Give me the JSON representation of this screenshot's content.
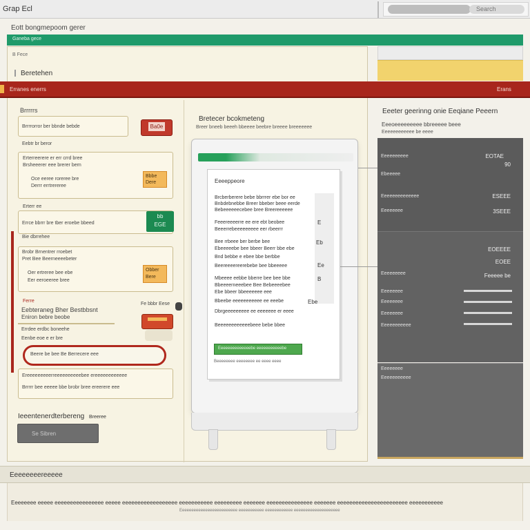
{
  "window": {
    "title": "Grap Ecl",
    "search_placeholder": "Search"
  },
  "breadcrumb": "Eott bongmepoom gerer",
  "green_band": "Ganeba gece",
  "left_panel": {
    "tag": "B Fece",
    "section_title": "Beretehen"
  },
  "red_band": {
    "title": "Erranes enerrs",
    "right_label": "Erans"
  },
  "forms": {
    "group1": {
      "heading": "Brrrrrs",
      "line1": "Brrrrorror ber bbnde bebde",
      "line2": "Eebtr br beror",
      "badge": "Ba0e"
    },
    "group2": {
      "line1": "Erterreerere er err crrd bree",
      "line2": "Brsheeerer eee brerer bern",
      "line3": "Oce eeree roreree bre",
      "line4": "Derrr errtrereree",
      "badge": "Bbbe Dere"
    },
    "group3": {
      "heading": "Erterr ee",
      "line1": "Errce bbrrr bre tber eroebe bbeed",
      "line2": "Bie dbrrehee",
      "badge_line1": "bb",
      "badge_line2": "EGE"
    },
    "group4": {
      "line1": "Brobr Brnentrer rroebet",
      "line2": "Pret Bee Beerneeeebeter",
      "line3": "Oer ertreree bee ebe",
      "line4": "Eer eeroeeree bree",
      "badge": "Obber Bere"
    },
    "group5": {
      "tag": "Ferre",
      "title": "Eebteraneg Bher Bestbbsnt",
      "subtitle": "Eniron bebre beobe",
      "side_label": "Fe bbbr Eese",
      "line1": "Errdee erdbc boneehe",
      "line2": "Eenbe eoe e er bre"
    },
    "oval_text": "Beere be bee Be Berrecere eee",
    "paragraph1": "Ereeeeeeeeerreeeeeeeeeebee ereeeeeeeeeeee",
    "paragraph2": "Brrrrr bee eeeee bbe brobr bree ereerere eee",
    "bottom_label": "Ieeentenerdterbereng",
    "bottom_label_suffix": "Breeree",
    "button_label": "Se Sibren"
  },
  "preview": {
    "title": "Bretecer bcokmeteng",
    "subtitle": "Breer bneeb beeeh bbeeee beebre breeee breeeeeee",
    "document": {
      "title": "Eeeeppeore",
      "lines": [
        "Brcberberere bebe bbrrrer ebe bor ee",
        "Bnbdebnebbe Breer bbeber beee eerde",
        "Bebeeeeeecebee bree Breereeeeee",
        "Feeereeeerre ee ere ebt beobee",
        "Beeerrebeeeeeeeee eer rbeerrr",
        "Bee rrbeee ber berbe bee",
        "Ebeeeeebe bee bbeer Beerr bbe ebe",
        "Bnd bebbe e ebee bbe berbbe",
        "Beereeeereerebebe bee bbeeeee",
        "Mbeeee eebbe bberre bee bee bbe",
        "Bbeeeerneeebee Bee Bebeeeebee",
        "Ebe bbeer bbeeeeeee eee",
        "Bbeebe eeeeeeeeeee ee eeebe",
        "Dbrgeeeeeeeee ee eeeeeee er eeee",
        "Beeeeeeeeeeeebeee bebe bbee"
      ],
      "side_marks": [
        "E",
        "Eb",
        "Ee",
        "Ebe",
        "B"
      ],
      "green_bar": "Eeeeeeeeeeeeeebe eeeeeeeeeeebe",
      "caption": "Beeeeeeee eeeeeeee ee eeee eeee"
    }
  },
  "right_panel": {
    "title": "Eeeter geerinng onie Eeqiane Peeern",
    "subtitle": "Eeeoeeeeeeeee bbreeeee beee",
    "subtitle2": "Eeeeeeeeeeee be eeee",
    "rows": [
      {
        "label": "Eeeeeeeeee",
        "value": "EOTAE"
      },
      {
        "label": "",
        "value": "90"
      },
      {
        "label": "Ebeeeee",
        "value": ""
      },
      {
        "label": "Eeeeeeeeeeeeee",
        "value": "ESEEE"
      },
      {
        "label": "Eeeeeeee",
        "value": "3SEEE"
      },
      {
        "label": "",
        "value": "EOEEEE"
      },
      {
        "label": "",
        "value": "EOEE"
      },
      {
        "label": "Eeeeeeeee",
        "value": "Feeeee be"
      },
      {
        "label": "Eeeeeeee",
        "value": ""
      },
      {
        "label": "Eeeeeeee",
        "value": ""
      },
      {
        "label": "Eeeeeeee",
        "value": ""
      },
      {
        "label": "Eeeeeeeeeee",
        "value": ""
      },
      {
        "label": "Eeeeeeee",
        "value": ""
      },
      {
        "label": "Eeeeeeeeeee",
        "value": ""
      }
    ]
  },
  "bottom": {
    "label": "Eeeeeeeereeeee",
    "footer": "Eeeeeeee eeeee eeeeeeeeeeeeeeee eeeee eeeeeeeeeeeeeeeeee eeeeeeeeeee eeeeeeeee eeeeeee eeeeeeeeeeeeeee eeeeeee eeeeeeeeeeeeeeeeeeeeeee eeeeeeeeeee",
    "caption": "Eeeeeeeeeeeeeeeeeeeeeeeee eeeeeeeeeee eeeeeeeeeeee eeeeeeeeeeeeeeeeeeee"
  },
  "colors": {
    "accent_red": "#a8261c",
    "accent_green": "#1f9a6a",
    "accent_yellow": "#f2d36d",
    "panel_dark": "#5b5b5b"
  }
}
